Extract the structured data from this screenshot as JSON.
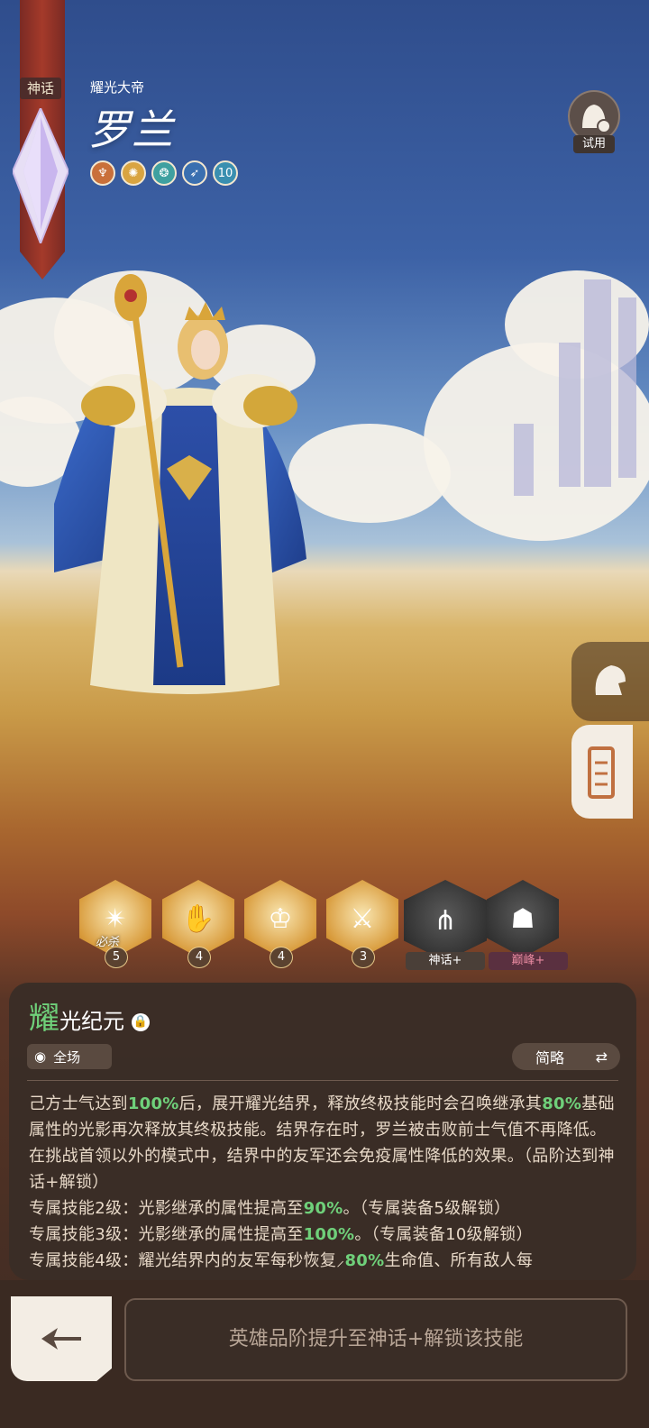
{
  "hero": {
    "rarity_tag": "神话",
    "subtitle": "耀光大帝",
    "name": "罗兰",
    "badges": [
      {
        "icon": "fire-guild-icon",
        "color": "#c9703a"
      },
      {
        "icon": "sun-icon",
        "color": "#d9a441"
      },
      {
        "icon": "emblem-icon",
        "color": "#3fa0a0"
      },
      {
        "icon": "feather-icon",
        "color": "#3a6fb0"
      },
      {
        "icon": "level-badge",
        "label": "10",
        "color": "#3a8fb0"
      }
    ],
    "trial_label": "试用"
  },
  "skills": [
    {
      "icon": "radiant-burst-icon",
      "level": "5",
      "tag": "必杀",
      "locked": false
    },
    {
      "icon": "summon-icon",
      "level": "4",
      "locked": false
    },
    {
      "icon": "crown-hand-icon",
      "level": "4",
      "locked": false
    },
    {
      "icon": "sword-strike-icon",
      "level": "3",
      "locked": false
    },
    {
      "icon": "claw-icon",
      "label": "神话+",
      "locked": true,
      "tag_color": "#4a3f38"
    },
    {
      "icon": "guardian-icon",
      "label": "巅峰+",
      "locked": true,
      "tag_color": "#5a3040"
    }
  ],
  "skill_detail": {
    "title_first": "耀",
    "title_rest": "光纪元",
    "scope": "全场",
    "brief_label": "简略",
    "desc": {
      "p1": "己方士气达到",
      "h1": "100%",
      "p2": "后，展开耀光结界，释放终极技能时会召唤继承其",
      "h2": "80%",
      "p3": "基础属性的光影再次释放其终极技能。结界存在时，罗兰被击败前士气值不再降低。在挑战首领以外的模式中，结界中的友军还会免疫属性降低的效果。（品阶达到神话+解锁）",
      "l2a": "专属技能2级：光影继承的属性提高至",
      "l2h": "90%",
      "l2b": "。（专属装备5级解锁）",
      "l3a": "专属技能3级：光影继承的属性提高至",
      "l3h": "100%",
      "l3b": "。（专属装备10级解锁）",
      "l4a": "专属技能4级：耀光结界内的友军每秒恢复",
      "l4h": "80%",
      "l4b": "生命值、所有敌人每"
    }
  },
  "upgrade_text": "英雄品阶提升至神话+解锁该技能"
}
